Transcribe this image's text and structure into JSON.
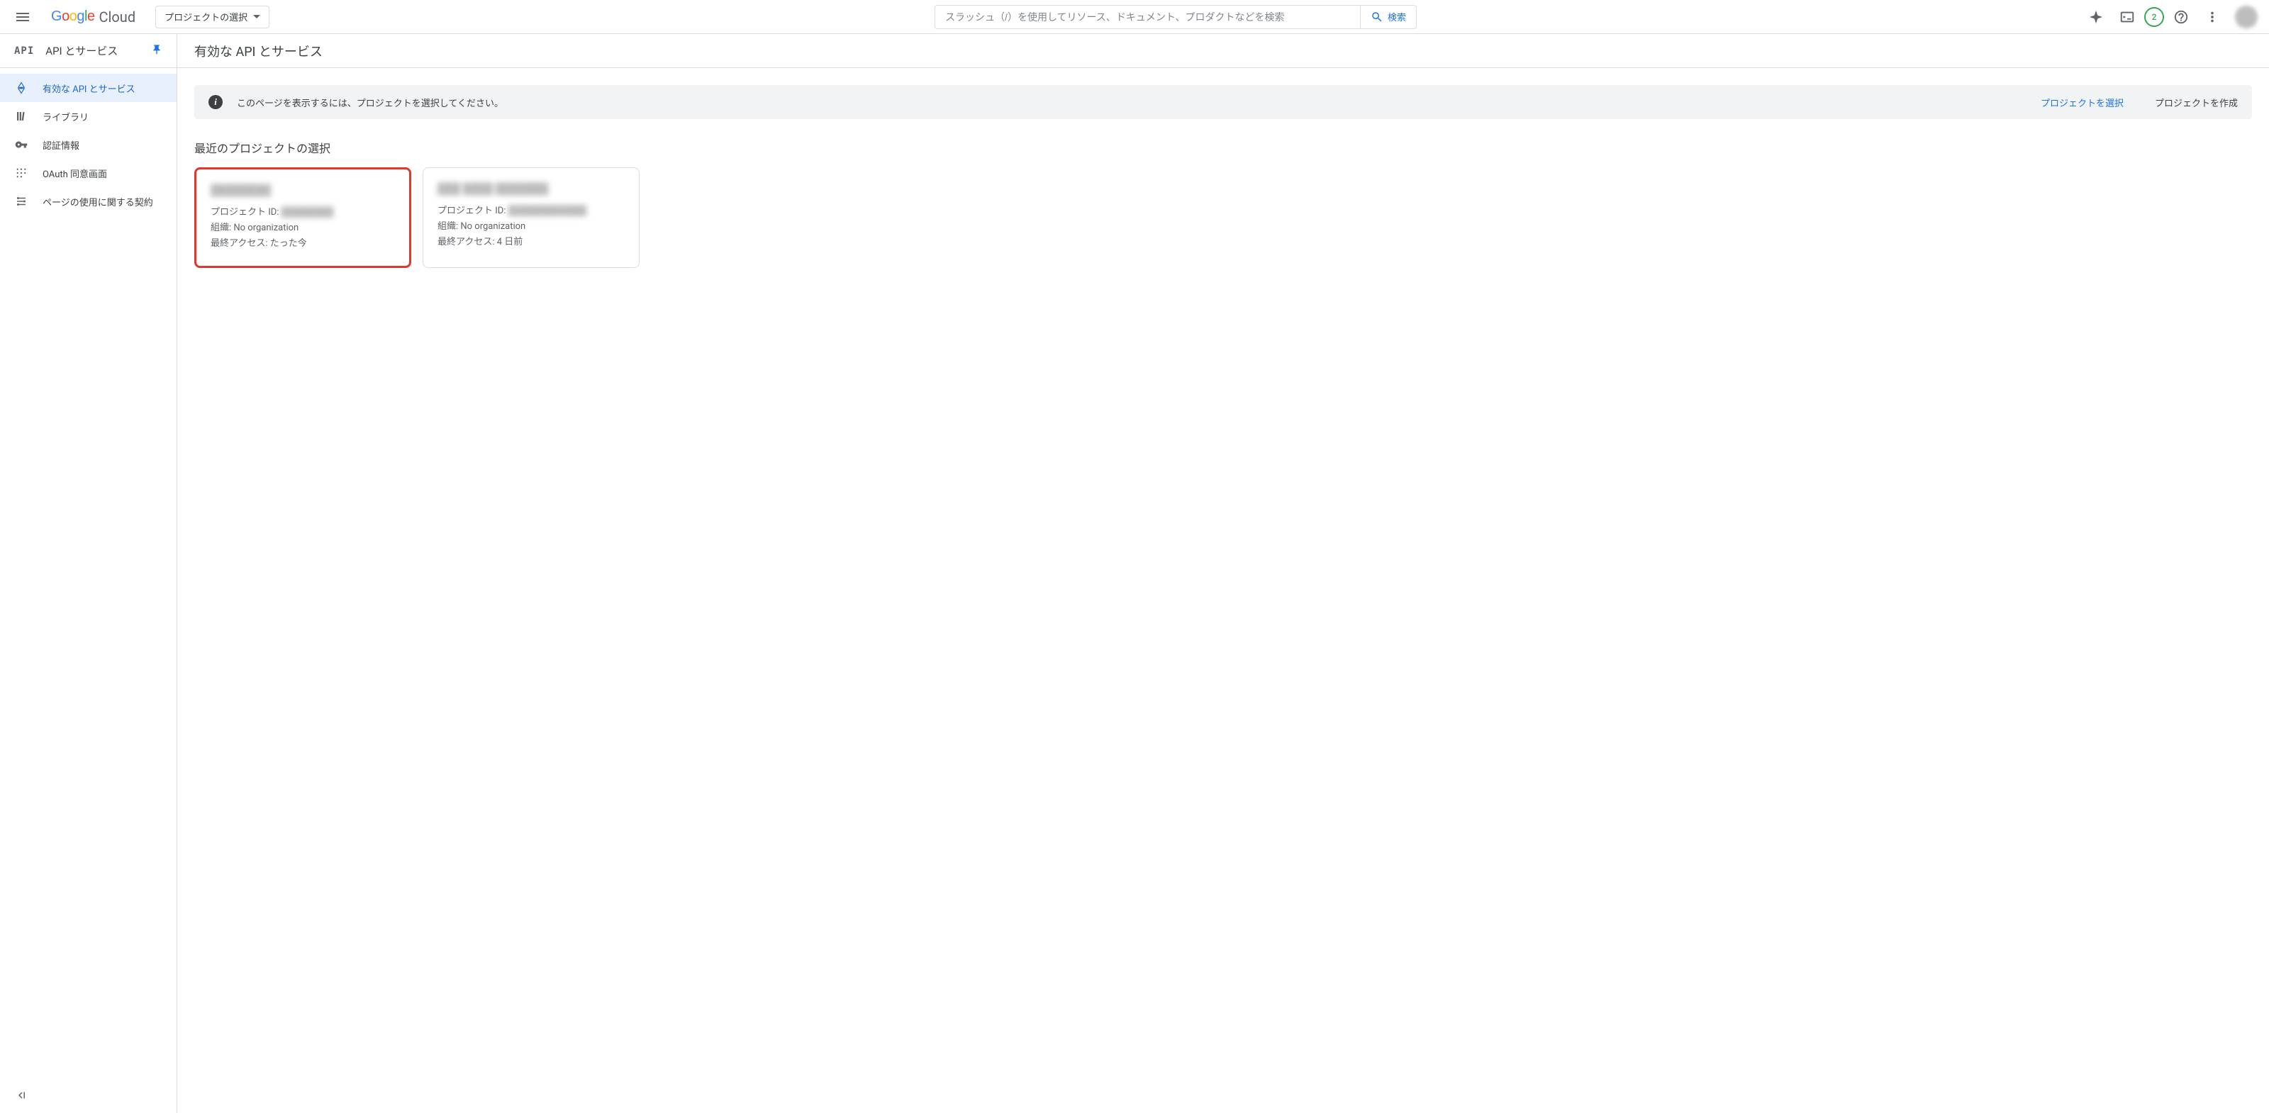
{
  "header": {
    "logo_cloud": "Cloud",
    "project_selector": "プロジェクトの選択",
    "search_placeholder": "スラッシュ（/）を使用してリソース、ドキュメント、プロダクトなどを検索",
    "search_button": "検索",
    "trial_count": "2"
  },
  "sidebar": {
    "badge": "API",
    "title": "API とサービス",
    "items": [
      {
        "label": "有効な API とサービス"
      },
      {
        "label": "ライブラリ"
      },
      {
        "label": "認証情報"
      },
      {
        "label": "OAuth 同意画面"
      },
      {
        "label": "ページの使用に関する契約"
      }
    ]
  },
  "main": {
    "title": "有効な API とサービス",
    "info_bar": {
      "text": "このページを表示するには、プロジェクトを選択してください。",
      "select_link": "プロジェクトを選択",
      "create_link": "プロジェクトを作成"
    },
    "recent_section_title": "最近のプロジェクトの選択",
    "labels": {
      "project_id": "プロジェクト ID: ",
      "org": "組織: ",
      "last_access": "最終アクセス: "
    },
    "projects": [
      {
        "name": "████████",
        "project_id": "████████",
        "org": "No organization",
        "last_access": "たった今"
      },
      {
        "name": "███ ████ ███████",
        "project_id": "████████████",
        "org": "No organization",
        "last_access": "4 日前"
      }
    ]
  }
}
